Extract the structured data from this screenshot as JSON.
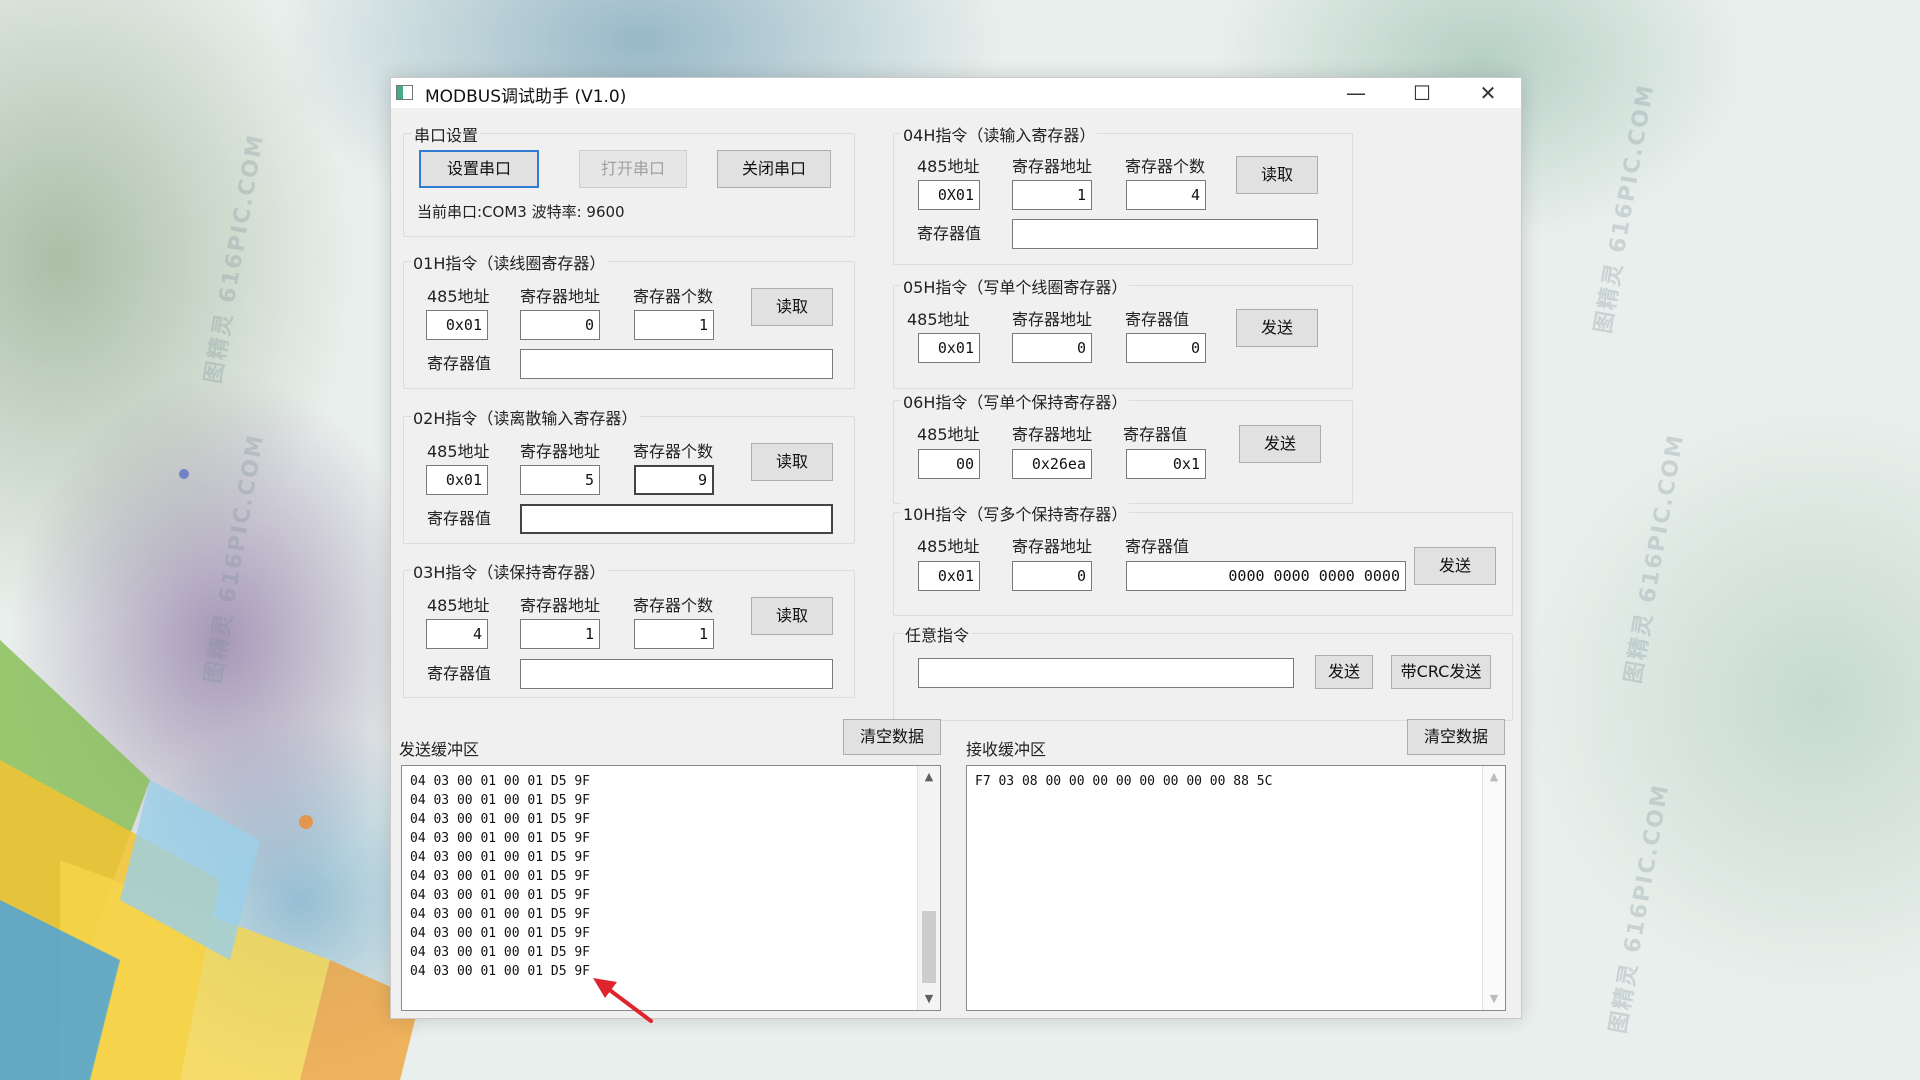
{
  "window": {
    "title": "MODBUS调试助手  (V1.0)",
    "min": "—",
    "max": "☐",
    "close": "✕"
  },
  "serial": {
    "group_label": "串口设置",
    "setup_btn": "设置串口",
    "open_btn": "打开串口",
    "close_btn": "关闭串口",
    "status": "当前串口:COM3 波特率: 9600"
  },
  "cmd01": {
    "label": "01H指令（读线圈寄存器）",
    "col1": "485地址",
    "col2": "寄存器地址",
    "col3": "寄存器个数",
    "addr485": "0x01",
    "reg_addr": "0",
    "reg_count": "1",
    "btn": "读取",
    "value_label": "寄存器值",
    "value": ""
  },
  "cmd02": {
    "label": "02H指令（读离散输入寄存器）",
    "col1": "485地址",
    "col2": "寄存器地址",
    "col3": "寄存器个数",
    "addr485": "0x01",
    "reg_addr": "5",
    "reg_count": "9",
    "btn": "读取",
    "value_label": "寄存器值",
    "value": ""
  },
  "cmd03": {
    "label": "03H指令（读保持寄存器）",
    "col1": "485地址",
    "col2": "寄存器地址",
    "col3": "寄存器个数",
    "addr485": "4",
    "reg_addr": "1",
    "reg_count": "1",
    "btn": "读取",
    "value_label": "寄存器值",
    "value": ""
  },
  "cmd04": {
    "label": "04H指令（读输入寄存器）",
    "col1": "485地址",
    "col2": "寄存器地址",
    "col3": "寄存器个数",
    "addr485": "0X01",
    "reg_addr": "1",
    "reg_count": "4",
    "btn": "读取",
    "value_label": "寄存器值",
    "value": ""
  },
  "cmd05": {
    "label": "05H指令（写单个线圈寄存器）",
    "col1": "485地址",
    "col2": "寄存器地址",
    "col3": "寄存器值",
    "addr485": "0x01",
    "reg_addr": "0",
    "reg_value": "0",
    "btn": "发送"
  },
  "cmd06": {
    "label": "06H指令（写单个保持寄存器）",
    "col1": "485地址",
    "col2": "寄存器地址",
    "col3": "寄存器值",
    "addr485": "00",
    "reg_addr": "0x26ea",
    "reg_value": "0x1",
    "btn": "发送"
  },
  "cmd10": {
    "label": "10H指令（写多个保持寄存器）",
    "col1": "485地址",
    "col2": "寄存器地址",
    "col3": "寄存器值",
    "addr485": "0x01",
    "reg_addr": "0",
    "reg_value": "0000 0000 0000 0000",
    "btn": "发送"
  },
  "custom": {
    "label": "任意指令",
    "value": "",
    "send_btn": "发送",
    "crc_btn": "带CRC发送"
  },
  "send_buffer": {
    "label": "发送缓冲区",
    "clear_btn": "清空数据",
    "lines": [
      "04 03 00 01 00 01 D5 9F",
      "04 03 00 01 00 01 D5 9F",
      "04 03 00 01 00 01 D5 9F",
      "04 03 00 01 00 01 D5 9F",
      "04 03 00 01 00 01 D5 9F",
      "04 03 00 01 00 01 D5 9F",
      "04 03 00 01 00 01 D5 9F",
      "04 03 00 01 00 01 D5 9F",
      "04 03 00 01 00 01 D5 9F",
      "04 03 00 01 00 01 D5 9F",
      "04 03 00 01 00 01 D5 9F"
    ]
  },
  "recv_buffer": {
    "label": "接收缓冲区",
    "clear_btn": "清空数据",
    "lines": [
      "F7 03 08 00 00 00 00 00 00 00 00 88 5C"
    ]
  },
  "background": {
    "watermark": "图精灵 616PIC.COM"
  },
  "colors": {
    "accent": "#2f7bd6",
    "arrow": "#e0242b",
    "window_bg": "#f0f0f0"
  }
}
